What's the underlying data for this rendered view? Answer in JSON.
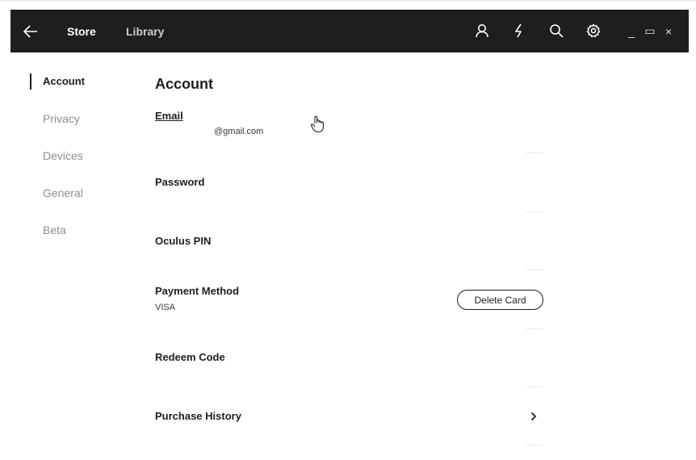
{
  "titlebar": {
    "nav": [
      {
        "label": "Store"
      },
      {
        "label": "Library"
      }
    ],
    "icons": [
      "back-arrow-icon",
      "profile-icon",
      "lightning-icon",
      "search-icon",
      "gear-icon"
    ],
    "window_controls": {
      "minimize": "_",
      "maximize": "▭",
      "close": "×"
    }
  },
  "sidebar": {
    "items": [
      {
        "label": "Account",
        "active": true
      },
      {
        "label": "Privacy",
        "active": false
      },
      {
        "label": "Devices",
        "active": false
      },
      {
        "label": "General",
        "active": false
      },
      {
        "label": "Beta",
        "active": false
      }
    ]
  },
  "main": {
    "title": "Account",
    "email": {
      "label": "Email",
      "value": "@gmail.com"
    },
    "password": {
      "label": "Password"
    },
    "pin": {
      "label": "Oculus PIN"
    },
    "payment": {
      "label": "Payment Method",
      "value": "VISA",
      "button": "Delete Card"
    },
    "redeem": {
      "label": "Redeem Code"
    },
    "history": {
      "label": "Purchase History",
      "chevron": "›"
    }
  },
  "colors": {
    "titlebar_bg": "#1c1e20",
    "text": "#1c1e20",
    "muted": "#8d8e90"
  }
}
